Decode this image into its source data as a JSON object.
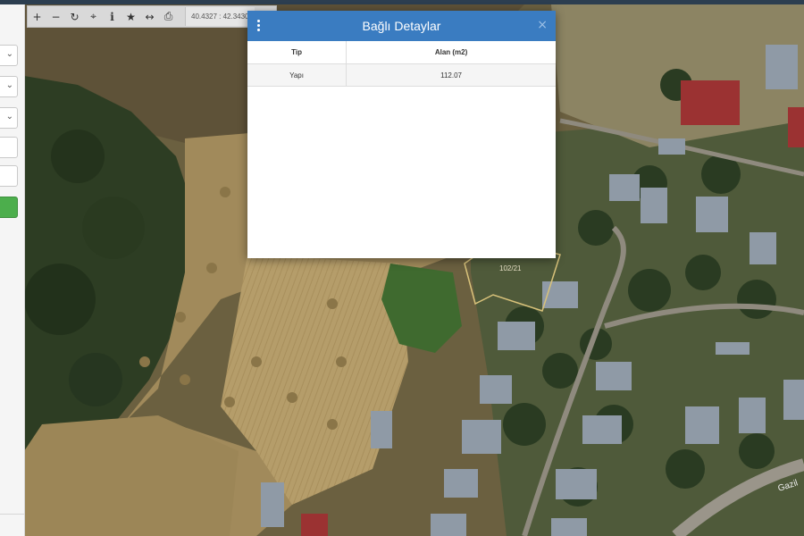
{
  "toolbar": {
    "coordinates": "40.4327 : 42.3430",
    "tools": [
      {
        "name": "zoom-in-button",
        "icon": "plus-icon",
        "glyph": "+"
      },
      {
        "name": "zoom-out-button",
        "icon": "minus-icon",
        "glyph": "−"
      },
      {
        "name": "refresh-button",
        "icon": "refresh-icon",
        "glyph": "↻"
      },
      {
        "name": "locate-button",
        "icon": "crosshair-icon",
        "glyph": "⌖"
      },
      {
        "name": "info-button",
        "icon": "info-icon",
        "glyph": "i"
      },
      {
        "name": "favorite-button",
        "icon": "star-icon",
        "glyph": "★"
      },
      {
        "name": "measure-button",
        "icon": "arrows-horizontal-icon",
        "glyph": "↔"
      },
      {
        "name": "print-button",
        "icon": "print-icon",
        "glyph": "⎙"
      }
    ]
  },
  "modal": {
    "title": "Bağlı Detaylar",
    "menu_icon": "kebab-menu-icon",
    "close_icon": "close-icon",
    "close_glyph": "×",
    "columns": [
      "Tip",
      "Alan (m2)"
    ],
    "rows": [
      [
        "Yapı",
        "112.07"
      ]
    ]
  },
  "map": {
    "parcel_label": "102/21",
    "road_label": "Gazil",
    "parcel_outline_color": "#d8c27a"
  }
}
